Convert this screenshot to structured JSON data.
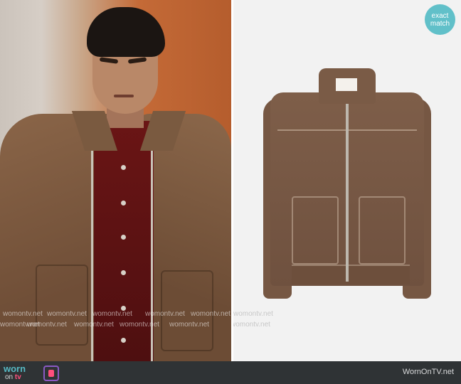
{
  "badge": {
    "line1": "exact",
    "line2": "match"
  },
  "watermark": {
    "text": "womontv.net"
  },
  "footer": {
    "logo_worn": "worn",
    "logo_on": "on",
    "logo_tv": "tv",
    "site": "WornOnTV.net"
  },
  "colors": {
    "badge": "#61c0c9",
    "footer_bg": "#2f3335",
    "logo_accent": "#ff4f7d",
    "logo_teal": "#56b8c3"
  }
}
